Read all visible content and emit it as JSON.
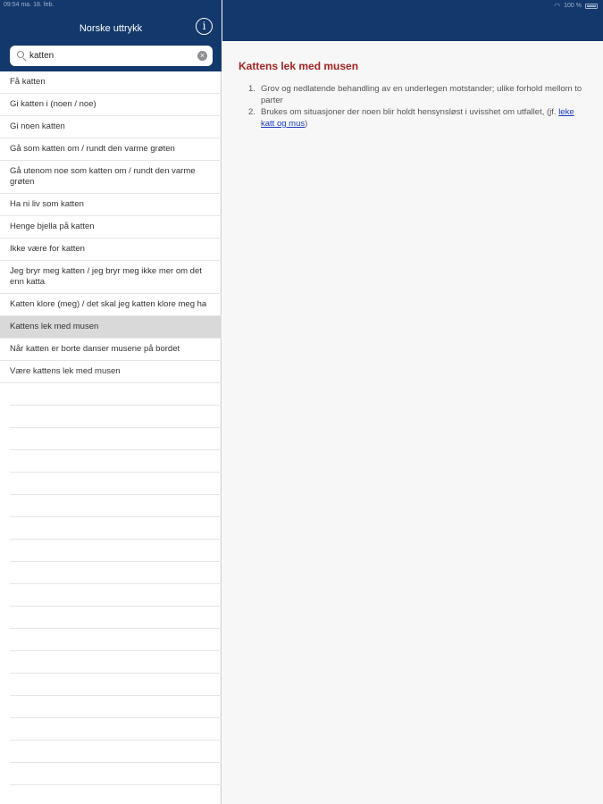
{
  "status_bar": {
    "time_date": "09:54  ma. 18. feb.",
    "battery": "100 %"
  },
  "sidebar": {
    "title": "Norske uttrykk",
    "search": {
      "value": "katten"
    },
    "results": [
      {
        "label": "Få katten"
      },
      {
        "label": "Gi katten i (noen / noe)"
      },
      {
        "label": "Gi noen katten"
      },
      {
        "label": "Gå som katten om / rundt den varme grøten"
      },
      {
        "label": "Gå utenom noe som katten om / rundt den varme grøten"
      },
      {
        "label": "Ha ni liv som katten"
      },
      {
        "label": "Henge bjella på katten"
      },
      {
        "label": "Ikke være for katten"
      },
      {
        "label": "Jeg bryr meg katten / jeg bryr meg ikke mer om det enn katta"
      },
      {
        "label": "Katten klore (meg) / det skal jeg katten klore meg ha"
      },
      {
        "label": "Kattens lek med musen"
      },
      {
        "label": "Når katten er borte danser musene på bordet"
      },
      {
        "label": "Være kattens lek med musen"
      }
    ],
    "selected_index": 10
  },
  "detail": {
    "title": "Kattens lek med musen",
    "definitions": [
      {
        "num": "1.",
        "text": "Grov og nedlatende behandling av en underlegen motstander; ulike forhold mellom to parter"
      },
      {
        "num": "2.",
        "text_before": "Brukes om situasjoner der noen blir holdt hensynsløst i uvisshet om utfallet, (jf.",
        "link": "leke katt og mus",
        "text_after": ")"
      }
    ]
  },
  "colors": {
    "header": "#13386b",
    "title_accent": "#a52323",
    "link": "#1a3bbf",
    "selected_row": "#d9d9d9"
  },
  "icons": {
    "info": "info-icon",
    "search": "search-icon",
    "clear": "clear-icon"
  }
}
